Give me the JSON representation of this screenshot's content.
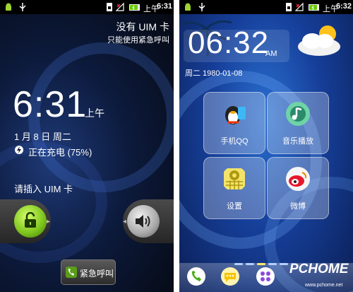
{
  "lockscreen": {
    "statusbar": {
      "time": "6:31",
      "period": "上午"
    },
    "no_uim": "没有 UIM 卡",
    "emergency_only": "只能使用紧急呼叫",
    "time": "6:31",
    "ampm": "上午",
    "date": "1 月 8 日 周二",
    "charging": "正在充电 (75%)",
    "insert_uim": "请插入 UIM 卡",
    "emergency_button": "紧急呼叫",
    "accent_green": "#7ac21a"
  },
  "homescreen": {
    "statusbar": {
      "time": "6:32",
      "period": "上午"
    },
    "clock_time": "06:32",
    "clock_ampm": "AM",
    "date": "周二 1980-01-08",
    "apps": [
      {
        "label": "手机QQ",
        "icon": "qq-penguin-icon"
      },
      {
        "label": "音乐播放",
        "icon": "music-note-icon"
      },
      {
        "label": "设置",
        "icon": "gear-icon"
      },
      {
        "label": "微博",
        "icon": "weibo-eye-icon"
      }
    ],
    "page_indicator": {
      "pages": 5,
      "active": 3
    },
    "watermark": "PCHOME",
    "watermark_url": "www.pchome.net"
  }
}
